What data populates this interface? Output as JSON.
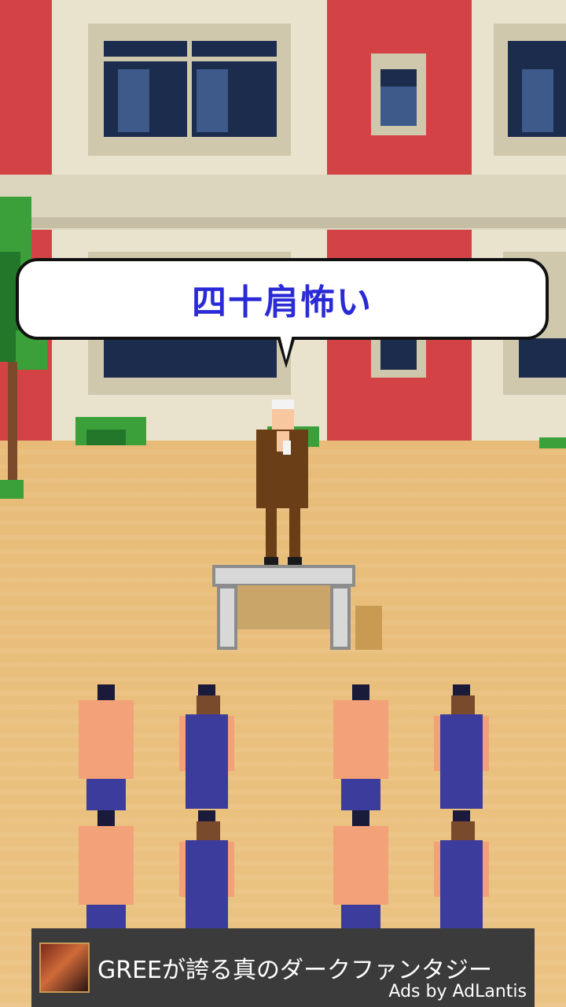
{
  "game": {
    "speech_bubble": "四十肩怖い"
  },
  "ad_banner": {
    "title": "GREEが誇る真のダークファンタジー",
    "attribution": "Ads by AdLantis",
    "icon": "dark-fantasy-character-icon"
  },
  "colors": {
    "brick": "#d34345",
    "ground": "#e9bf7d",
    "bubble_text": "#2a2ad6",
    "ad_background": "#3b3b3b"
  }
}
